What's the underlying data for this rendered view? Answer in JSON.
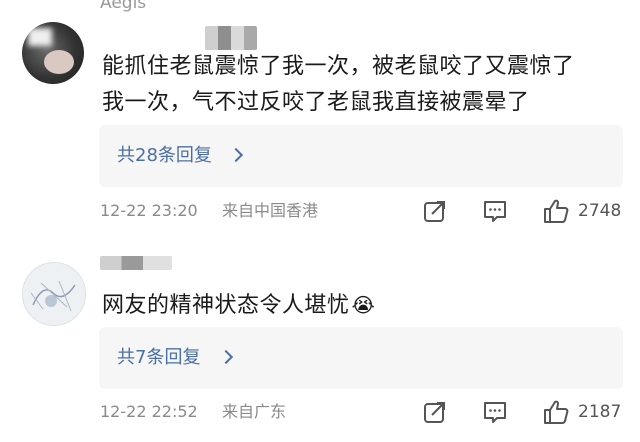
{
  "comments": [
    {
      "username": "Aegis",
      "text_line1": "能抓住老鼠震惊了我一次，被老鼠咬了又震惊了",
      "text_line2": "我一次，气不过反咬了老鼠我直接被震晕了",
      "replies_label": "共28条回复",
      "time": "12-22 23:20",
      "location": "来自中国香港",
      "likes": "2748"
    },
    {
      "username": "",
      "text": "网友的精神状态令人堪忧",
      "emoji": "😭",
      "replies_label": "共7条回复",
      "time": "12-22 22:52",
      "location": "来自广东",
      "likes": "2187"
    }
  ],
  "icons": {
    "share": "share-icon",
    "comment": "comment-icon",
    "like": "like-icon",
    "chevron": "chevron-right-icon"
  },
  "colors": {
    "link": "#4a6fa5",
    "meta": "#8a8a8a",
    "reply_bg": "#f6f6f6"
  }
}
